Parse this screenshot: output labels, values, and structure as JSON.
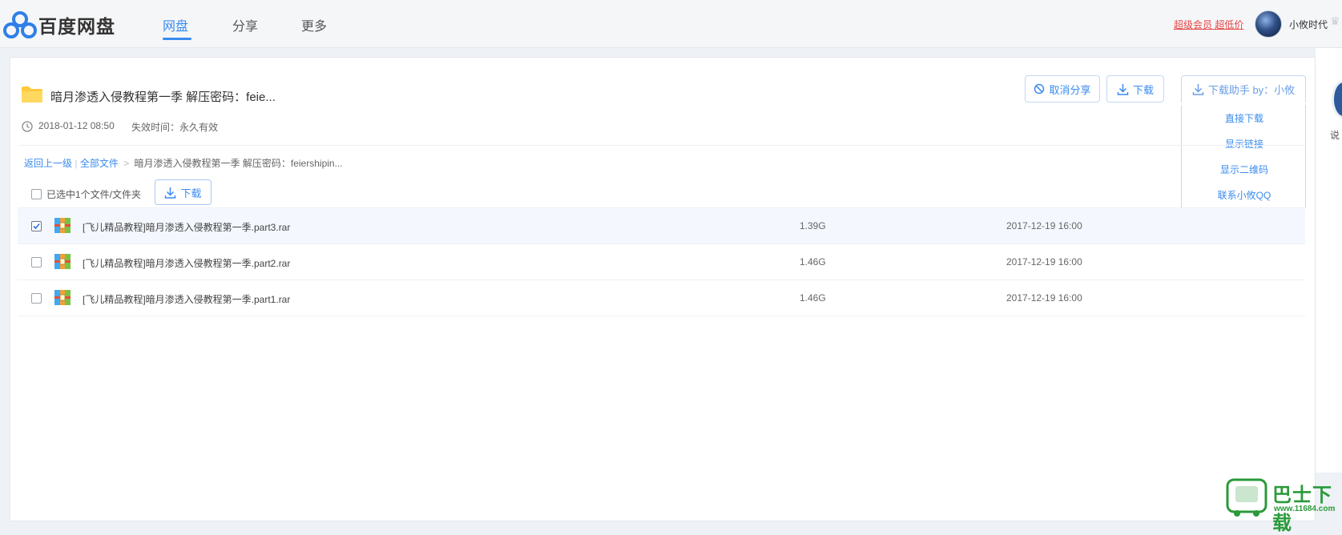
{
  "app": {
    "logo_text": "百度网盘"
  },
  "nav": {
    "tabs": [
      {
        "label": "网盘",
        "active": true
      },
      {
        "label": "分享",
        "active": false
      },
      {
        "label": "更多",
        "active": false
      }
    ]
  },
  "user": {
    "vip_link": "超级会员 超低价",
    "name": "小攸时代"
  },
  "share": {
    "title": "暗月渗透入侵教程第一季 解压密码：feie...",
    "date": "2018-01-12 08:50",
    "expire": "失效时间：永久有效"
  },
  "toolbar": {
    "cancel_share": "取消分享",
    "download": "下载",
    "helper": "下载助手 by：小攸"
  },
  "helper_menu": {
    "items": [
      "直接下载",
      "显示链接",
      "显示二维码",
      "联系小攸QQ"
    ]
  },
  "breadcrumb": {
    "back": "返回上一级",
    "all_files": "全部文件",
    "sep": ">",
    "current": "暗月渗透入侵教程第一季 解压密码：feiershipin..."
  },
  "selection": {
    "text": "已选中1个文件/文件夹",
    "download": "下载"
  },
  "files": [
    {
      "name": "[飞儿精品教程]暗月渗透入侵教程第一季.part3.rar",
      "size": "1.39G",
      "date": "2017-12-19 16:00",
      "checked": true
    },
    {
      "name": "[飞儿精品教程]暗月渗透入侵教程第一季.part2.rar",
      "size": "1.46G",
      "date": "2017-12-19 16:00",
      "checked": false
    },
    {
      "name": "[飞儿精品教程]暗月渗透入侵教程第一季.part1.rar",
      "size": "1.46G",
      "date": "2017-12-19 16:00",
      "checked": false
    }
  ],
  "side": {
    "peek_text": "说"
  },
  "watermark": {
    "title": "巴士下载",
    "url": "www.11684.com"
  },
  "colors": {
    "accent": "#3a8bef",
    "vip": "#e64545",
    "folder": "#ffc93d"
  }
}
